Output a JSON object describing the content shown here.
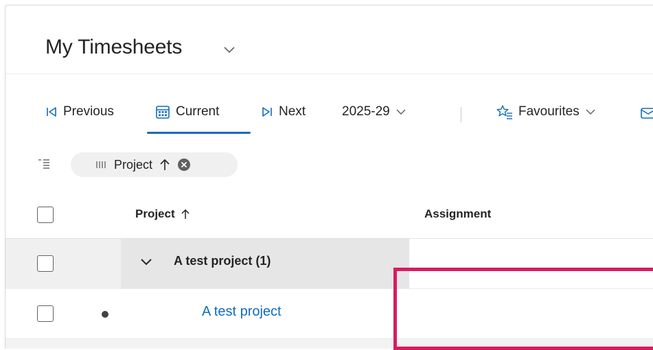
{
  "header": {
    "title": "My Timesheets",
    "title_icon": "chevron-down-icon"
  },
  "toolbar": {
    "previous_label": "Previous",
    "current_label": "Current",
    "next_label": "Next",
    "period_value": "2025-29",
    "favourites_label": "Favourites",
    "icons": {
      "previous": "skip-back-icon",
      "current": "calendar-icon",
      "next": "skip-forward-icon",
      "favourites": "star-list-icon"
    }
  },
  "filter": {
    "chip_label": "Project",
    "chip_sort": "ascending",
    "chip_icon": "column-grip-icon"
  },
  "grid": {
    "columns": [
      "Project",
      "Assignment"
    ],
    "groups": [
      {
        "label": "A test project (1)",
        "rows": [
          {
            "project": "A test project",
            "assignment": ""
          }
        ]
      }
    ]
  },
  "colors": {
    "accent": "#0f6cbd",
    "highlight": "#d81b60",
    "group_band": "#e6e6e6"
  }
}
